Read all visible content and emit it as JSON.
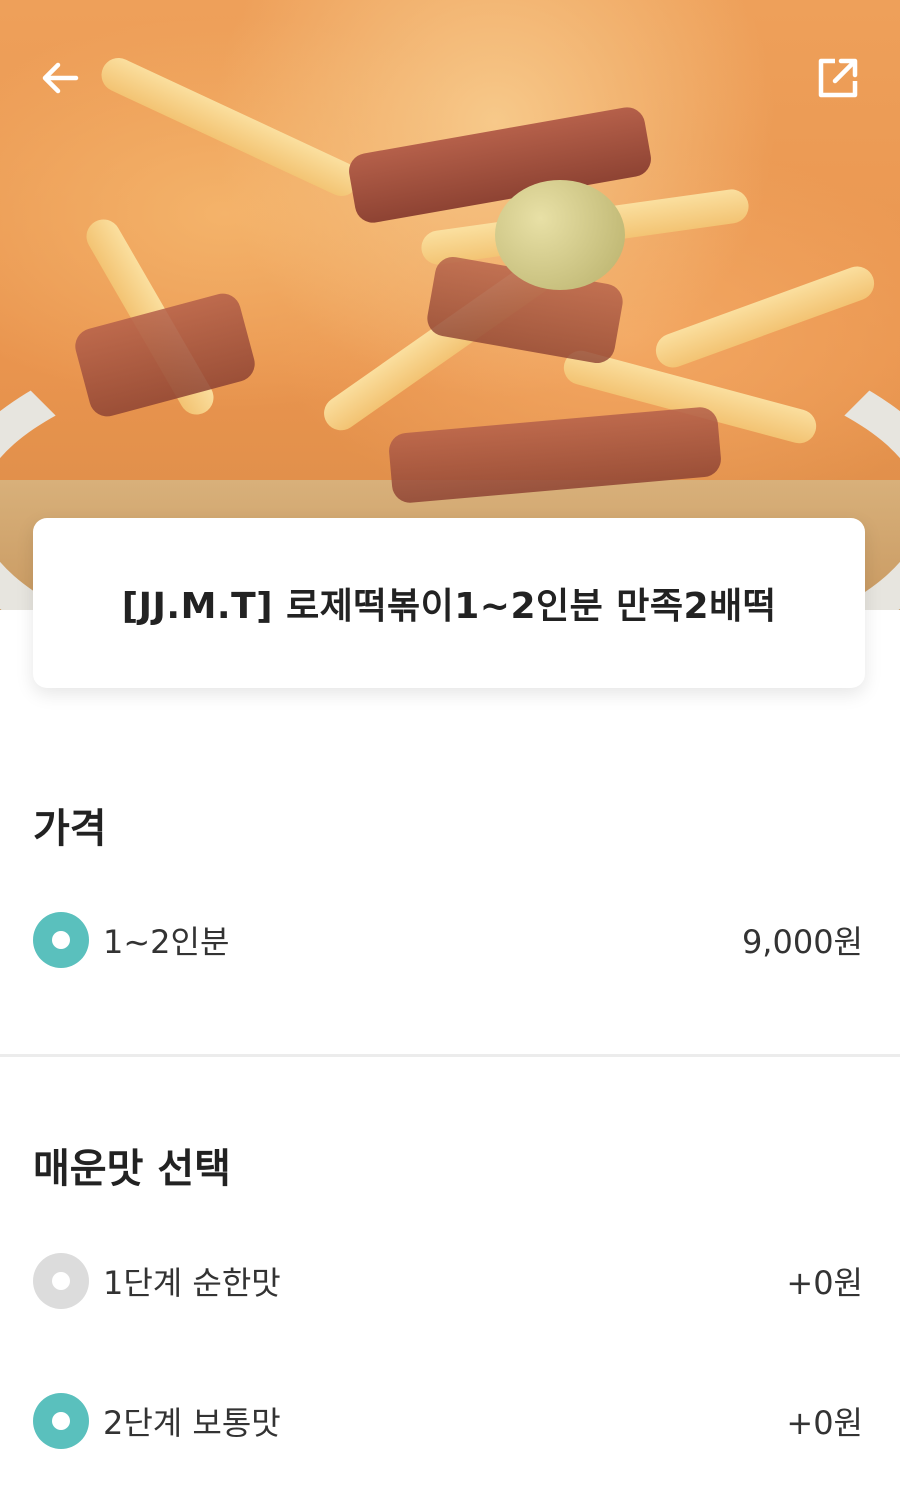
{
  "header": {
    "back_icon": "arrow-left-icon",
    "share_icon": "share-external-icon"
  },
  "product": {
    "title": "[JJ.M.T] 로제떡볶이1~2인분 만족2배떡"
  },
  "price_section": {
    "title": "가격",
    "options": [
      {
        "label": "1~2인분",
        "price": "9,000원",
        "selected": true
      }
    ]
  },
  "spice_section": {
    "title": "매운맛 선택",
    "options": [
      {
        "label": "1단계 순한맛",
        "price": "+0원",
        "selected": false
      },
      {
        "label": "2단계 보통맛",
        "price": "+0원",
        "selected": true
      }
    ]
  },
  "colors": {
    "accent": "#5ac0bd",
    "radio_off": "#dcdcdc"
  }
}
